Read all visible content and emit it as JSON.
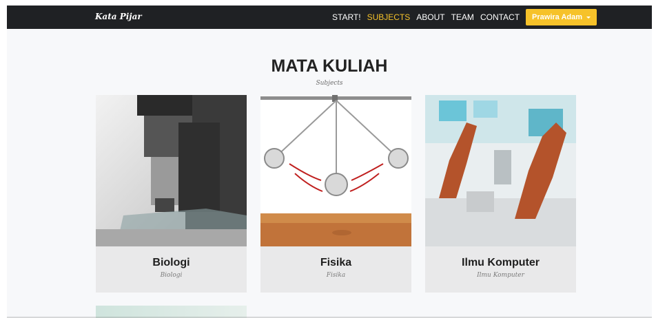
{
  "nav": {
    "brand": "Kata Pijar",
    "items": [
      {
        "label": "START!",
        "active": false
      },
      {
        "label": "SUBJECTS",
        "active": true
      },
      {
        "label": "ABOUT",
        "active": false
      },
      {
        "label": "TEAM",
        "active": false
      },
      {
        "label": "CONTACT",
        "active": false
      }
    ],
    "user_button": "Prawira Adam"
  },
  "page": {
    "title": "MATA KULIAH",
    "subtitle": "Subjects"
  },
  "cards": [
    {
      "title": "Biologi",
      "subtitle": "Biologi",
      "image": "microscope"
    },
    {
      "title": "Fisika",
      "subtitle": "Fisika",
      "image": "newtons-cradle"
    },
    {
      "title": "Ilmu Komputer",
      "subtitle": "Ilmu Komputer",
      "image": "robot-arms"
    }
  ],
  "colors": {
    "navbar": "#1f2124",
    "accent": "#f6c22a",
    "card_bg": "#e9e9ea",
    "page_bg": "#f7f8fa"
  }
}
